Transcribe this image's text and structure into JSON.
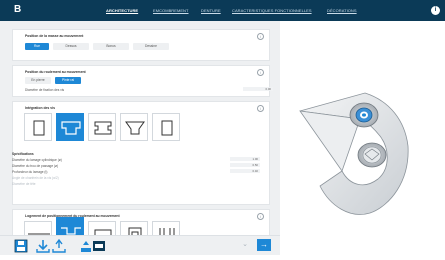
{
  "app": {
    "logo_letter": "B"
  },
  "nav": {
    "tabs": [
      {
        "label": "ARCHITECTURE",
        "active": true
      },
      {
        "label": "EMCOMBREMENT",
        "active": false
      },
      {
        "label": "DENTURE",
        "active": false
      },
      {
        "label": "CARACTERISTIQUES FONCTIONNELLES",
        "active": false
      },
      {
        "label": "DÉCORATIONS",
        "active": false
      }
    ],
    "info_icon": "i"
  },
  "position_card": {
    "title": "Position de la masse au mouvement",
    "options": [
      "Rue",
      "Dessus",
      "Bonus",
      "Dessine"
    ],
    "selected": "Rue"
  },
  "bearing_card": {
    "title": "Position du roulement au mouvement",
    "options": [
      "En pierre",
      "Pinte rai"
    ],
    "selected": "Pinte rai",
    "row_label": "Diamètre de fixation des vis",
    "row_value": "0.00"
  },
  "integration_card": {
    "title": "Intégration des vis",
    "selected_index": 1,
    "specs_title": "Spécifications",
    "specs": [
      {
        "label": "Diamètre du lamage cylindrique (ø)",
        "value": "1.00"
      },
      {
        "label": "Diamètre du trou de passage (ø)",
        "value": "0.50"
      },
      {
        "label": "Profondeur du lamage (t)",
        "value": "0.40"
      }
    ],
    "faint_specs": [
      "Angle de chanfrein de la vis (α/2)",
      "Diamètre de tête"
    ]
  },
  "positioning_card": {
    "title": "Logement de positionnement du roulement au mouvement",
    "selected_index": 1
  },
  "bottom": {
    "next_label": "→",
    "chevron": "⌄"
  },
  "colors": {
    "topbar": "#0b3a57",
    "accent": "#1e88d6",
    "pane_bg": "#eef0f2"
  }
}
